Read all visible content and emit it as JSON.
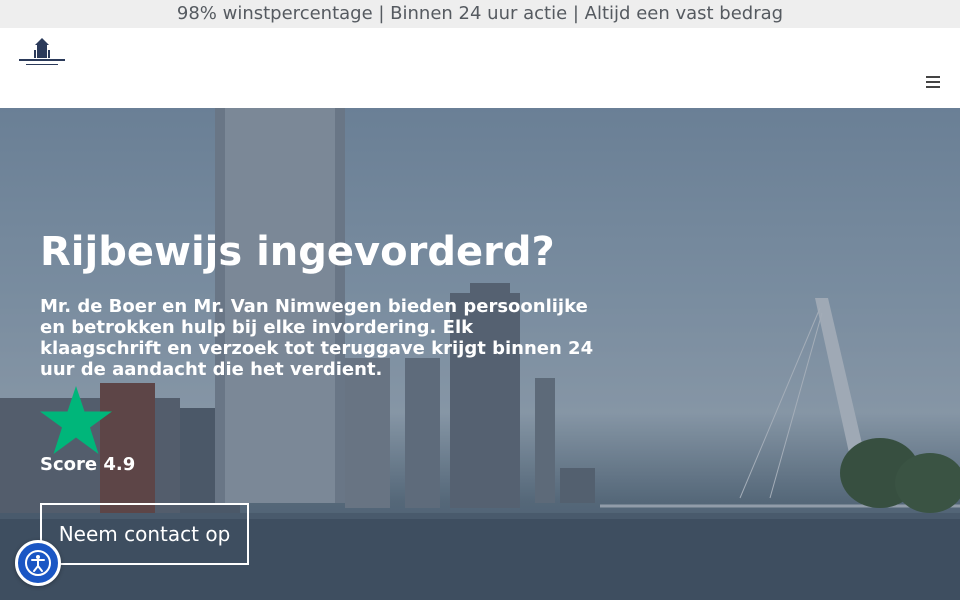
{
  "topbar": {
    "text": "98% winstpercentage  |  Binnen 24 uur actie  |  Altijd een vast bedrag"
  },
  "header": {
    "logo_text": "De Boer & Van Nimwegen",
    "menu_icon": "hamburger-menu-icon"
  },
  "hero": {
    "title": "Rijbewijs ingevorderd?",
    "subtitle": "Mr. de Boer en Mr. Van Nimwegen bieden persoonlijke en betrokken hulp bij elke invordering. Elk klaagschrift en verzoek tot teruggave krijgt binnen 24 uur de aandacht die het verdient.",
    "rating_icon": "trustpilot-star-icon",
    "score_label": "Score 4.9",
    "cta_label": "Neem contact op"
  },
  "accessibility": {
    "icon": "accessibility-icon"
  },
  "colors": {
    "star_green": "#00b67a",
    "a11y_blue": "#1a56c4",
    "topbar_bg": "#eeeeee"
  }
}
